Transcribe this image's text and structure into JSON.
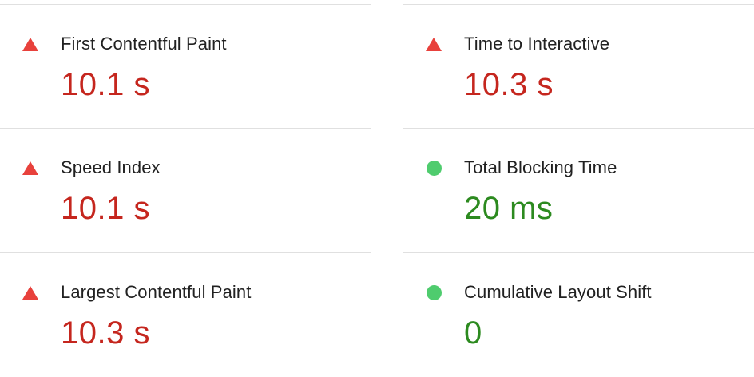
{
  "metrics_left": [
    {
      "label": "First Contentful Paint",
      "value": "10.1 s",
      "status": "fail",
      "icon": "warning-triangle-icon"
    },
    {
      "label": "Speed Index",
      "value": "10.1 s",
      "status": "fail",
      "icon": "warning-triangle-icon"
    },
    {
      "label": "Largest Contentful Paint",
      "value": "10.3 s",
      "status": "fail",
      "icon": "warning-triangle-icon"
    }
  ],
  "metrics_right": [
    {
      "label": "Time to Interactive",
      "value": "10.3 s",
      "status": "fail",
      "icon": "warning-triangle-icon"
    },
    {
      "label": "Total Blocking Time",
      "value": "20 ms",
      "status": "pass",
      "icon": "pass-circle-icon"
    },
    {
      "label": "Cumulative Layout Shift",
      "value": "0",
      "status": "pass",
      "icon": "pass-circle-icon"
    }
  ],
  "colors": {
    "fail_value": "#c5261e",
    "fail_icon": "#e8413c",
    "pass_value": "#2c8a1f",
    "pass_icon": "#4fcc6e",
    "divider": "#e0e0e0",
    "label_text": "#212121"
  }
}
